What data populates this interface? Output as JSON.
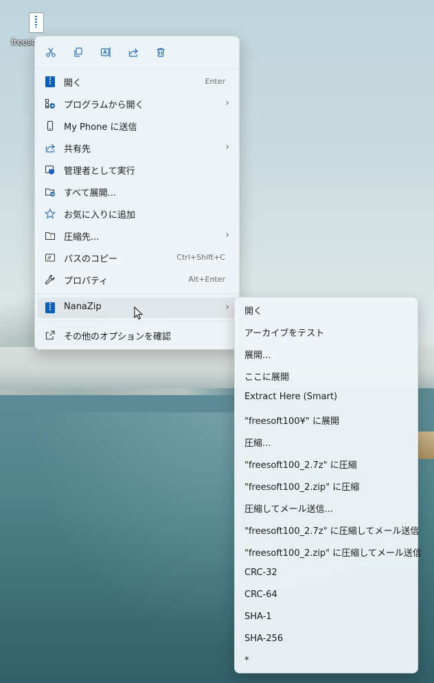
{
  "desktop": {
    "icon_label": "freeso"
  },
  "toolbar": {
    "buttons": [
      {
        "name": "cut",
        "icon": "scissors-icon"
      },
      {
        "name": "copy",
        "icon": "copy-icon"
      },
      {
        "name": "rename",
        "icon": "rename-icon"
      },
      {
        "name": "share",
        "icon": "share-icon"
      },
      {
        "name": "delete",
        "icon": "trash-icon"
      }
    ]
  },
  "menu": {
    "items": [
      {
        "label": "開く",
        "accel": "Enter"
      },
      {
        "label": "プログラムから開く",
        "submenu": true
      },
      {
        "label": "My Phone に送信"
      },
      {
        "label": "共有先",
        "submenu": true
      },
      {
        "label": "管理者として実行"
      },
      {
        "label": "すべて展開..."
      },
      {
        "label": "お気に入りに追加"
      },
      {
        "label": "圧縮先...",
        "submenu": true
      },
      {
        "label": "パスのコピー",
        "accel": "Ctrl+Shift+C"
      },
      {
        "label": "プロパティ",
        "accel": "Alt+Enter"
      },
      {
        "label": "NanaZip",
        "submenu": true
      },
      {
        "label": "その他のオプションを確認"
      }
    ]
  },
  "submenu": {
    "items": [
      "開く",
      "アーカイブをテスト",
      "展開...",
      "ここに展開",
      "Extract Here (Smart)",
      "\"freesoft100¥\" に展開",
      "圧縮...",
      "\"freesoft100_2.7z\" に圧縮",
      "\"freesoft100_2.zip\" に圧縮",
      "圧縮してメール送信...",
      "\"freesoft100_2.7z\" に圧縮してメール送信",
      "\"freesoft100_2.zip\" に圧縮してメール送信",
      "CRC-32",
      "CRC-64",
      "SHA-1",
      "SHA-256",
      "*"
    ]
  },
  "colors": {
    "accent": "#0067c0",
    "menu_bg": "#eef5f8",
    "hover_bg": "#e6ecef"
  }
}
